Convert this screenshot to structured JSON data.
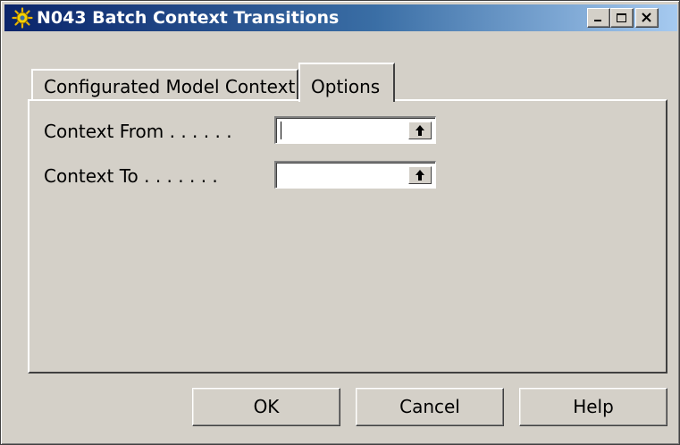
{
  "window": {
    "title": "N043 Batch Context Transitions",
    "icon": "gear-icon"
  },
  "caption_buttons": {
    "minimize": "minimize-icon",
    "maximize": "maximize-icon",
    "close": "close-icon"
  },
  "tabs": [
    {
      "label": "Configurated Model Context",
      "active": false
    },
    {
      "label": "Options",
      "active": true
    }
  ],
  "fields": [
    {
      "label": "Context From . . . . . .",
      "value": "",
      "lookup_icon": "up-arrow-icon"
    },
    {
      "label": "Context To . . . . . . .",
      "value": "",
      "lookup_icon": "up-arrow-icon"
    }
  ],
  "buttons": {
    "ok": "OK",
    "cancel": "Cancel",
    "help": "Help"
  }
}
